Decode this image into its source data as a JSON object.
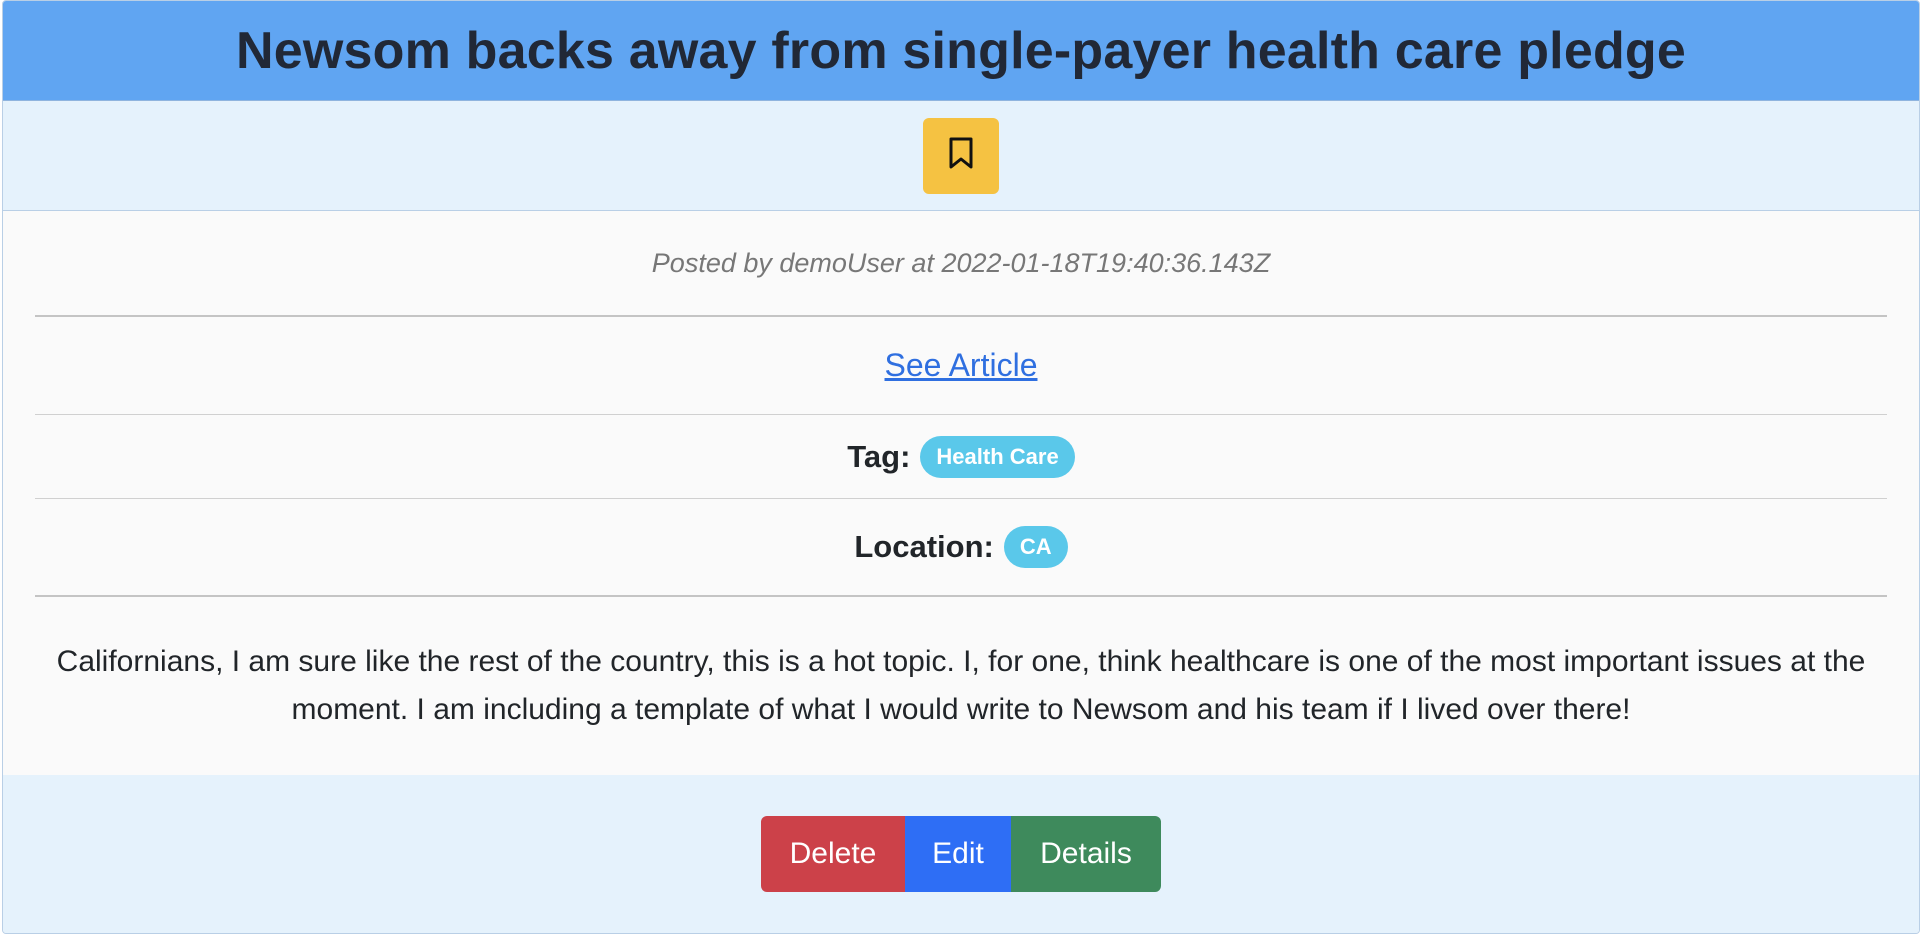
{
  "post": {
    "title": "Newsom backs away from single-payer health care pledge",
    "meta": "Posted by demoUser at 2022-01-18T19:40:36.143Z",
    "article_link": "See Article",
    "tag_label": "Tag:",
    "tag_value": "Health Care",
    "location_label": "Location:",
    "location_value": "CA",
    "description": "Californians, I am sure like the rest of the country, this is a hot topic. I, for one, think healthcare is one of the most important issues at the moment. I am including a template of what I would write to Newsom and his team if I lived over there!"
  },
  "actions": {
    "delete_label": "Delete",
    "edit_label": "Edit",
    "details_label": "Details"
  },
  "icons": {
    "bookmark": "bookmark-icon"
  },
  "colors": {
    "header": "#60a5f2",
    "bookmark_button": "#f5c242",
    "tag_pill": "#5ac8ea",
    "delete": "#cc4149",
    "edit": "#2e6ef5",
    "details": "#3e8a5c",
    "link": "#2f6fe0"
  }
}
